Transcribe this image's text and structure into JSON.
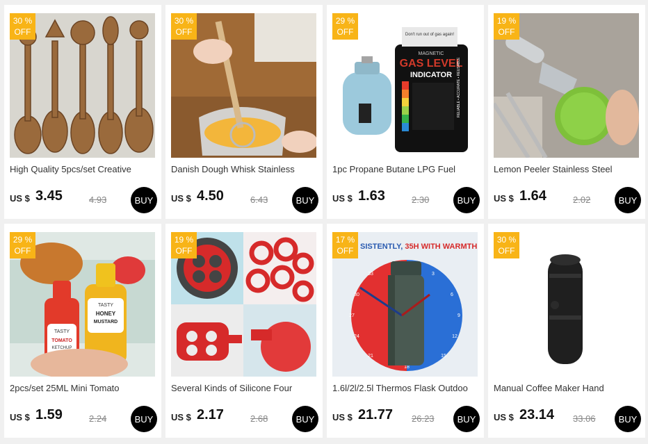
{
  "products": [
    {
      "discount_pct": "30 %",
      "discount_off": "OFF",
      "title": "High Quality 5pcs/set Creative",
      "currency": "US $",
      "price": "3.45",
      "old_price": "4.93",
      "buy": "BUY",
      "image": "vintage-spoons"
    },
    {
      "discount_pct": "30 %",
      "discount_off": "OFF",
      "title": "Danish Dough Whisk Stainless",
      "currency": "US $",
      "price": "4.50",
      "old_price": "6.43",
      "buy": "BUY",
      "image": "dough-whisk"
    },
    {
      "discount_pct": "29 %",
      "discount_off": "OFF",
      "title": "1pc Propane Butane LPG Fuel",
      "currency": "US $",
      "price": "1.63",
      "old_price": "2.30",
      "buy": "BUY",
      "image": "gas-level-indicator",
      "image_text": {
        "top": "Don't run out of gas again!",
        "line1": "MAGNETIC",
        "line2": "GAS LEVEL",
        "line3": "INDICATOR",
        "side": "RELIABLE • ACCURATE • REUSABLE"
      }
    },
    {
      "discount_pct": "19 %",
      "discount_off": "OFF",
      "title": "Lemon Peeler Stainless Steel",
      "currency": "US $",
      "price": "1.64",
      "old_price": "2.02",
      "buy": "BUY",
      "image": "lemon-peeler"
    },
    {
      "discount_pct": "29 %",
      "discount_off": "OFF",
      "title": "2pcs/set 25ML Mini Tomato",
      "currency": "US $",
      "price": "1.59",
      "old_price": "2.24",
      "buy": "BUY",
      "image": "sauce-bottles",
      "image_text": {
        "b1a": "TASTY",
        "b1b": "TOMATO",
        "b1c": "KETCHUP",
        "b2a": "TASTY",
        "b2b": "HONEY",
        "b2c": "MUSTARD"
      }
    },
    {
      "discount_pct": "19 %",
      "discount_off": "OFF",
      "title": "Several Kinds of Silicone Four",
      "currency": "US $",
      "price": "2.17",
      "old_price": "2.68",
      "buy": "BUY",
      "image": "silicone-egg-molds"
    },
    {
      "discount_pct": "17 %",
      "discount_off": "OFF",
      "title": "1.6l/2l/2.5l Thermos Flask Outdoo",
      "currency": "US $",
      "price": "21.77",
      "old_price": "26.23",
      "buy": "BUY",
      "image": "thermos-flask",
      "image_text": {
        "banner_a": "SISTENTLY, ",
        "banner_b": "35H WITH WARMTH",
        "n35": "35",
        "n3": "3",
        "n6": "6",
        "n9": "9",
        "n12": "12",
        "n15": "15",
        "n18": "18",
        "n21": "21",
        "n24": "24",
        "n27": "27",
        "n30": "30",
        "n33": "33"
      }
    },
    {
      "discount_pct": "30 %",
      "discount_off": "OFF",
      "title": "Manual Coffee Maker Hand",
      "currency": "US $",
      "price": "23.14",
      "old_price": "33.06",
      "buy": "BUY",
      "image": "coffee-maker"
    }
  ],
  "colors": {
    "badge": "#f8b417",
    "buy_button": "#000000",
    "background": "#f0f0f0"
  }
}
